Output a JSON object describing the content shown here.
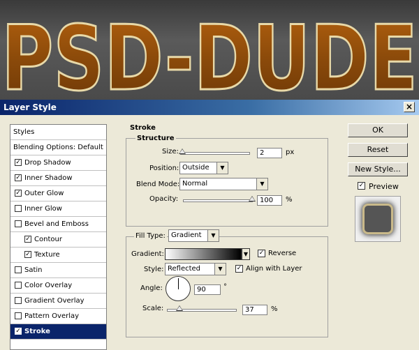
{
  "banner": {
    "text": "PSD-DUDE"
  },
  "window": {
    "title": "Layer Style",
    "close_glyph": "×"
  },
  "left_list": {
    "items": [
      {
        "label": "Styles",
        "checkbox": false,
        "checked": false
      },
      {
        "label": "Blending Options: Default",
        "checkbox": false,
        "checked": false
      },
      {
        "label": "Drop Shadow",
        "checkbox": true,
        "checked": true
      },
      {
        "label": "Inner Shadow",
        "checkbox": true,
        "checked": true
      },
      {
        "label": "Outer Glow",
        "checkbox": true,
        "checked": true
      },
      {
        "label": "Inner Glow",
        "checkbox": true,
        "checked": false
      },
      {
        "label": "Bevel and Emboss",
        "checkbox": true,
        "checked": false
      },
      {
        "label": "Contour",
        "checkbox": true,
        "checked": true
      },
      {
        "label": "Texture",
        "checkbox": true,
        "checked": true
      },
      {
        "label": "Satin",
        "checkbox": true,
        "checked": false
      },
      {
        "label": "Color Overlay",
        "checkbox": true,
        "checked": false
      },
      {
        "label": "Gradient Overlay",
        "checkbox": true,
        "checked": false
      },
      {
        "label": "Pattern Overlay",
        "checkbox": true,
        "checked": false
      },
      {
        "label": "Stroke",
        "checkbox": true,
        "checked": true,
        "selected": true
      }
    ]
  },
  "stroke": {
    "heading": "Stroke",
    "structure_heading": "Structure",
    "size_label": "Size:",
    "size_value": "2",
    "size_unit": "px",
    "position_label": "Position:",
    "position_value": "Outside",
    "blend_mode_label": "Blend Mode:",
    "blend_mode_value": "Normal",
    "opacity_label": "Opacity:",
    "opacity_value": "100",
    "opacity_unit": "%",
    "fill_type_label": "Fill Type:",
    "fill_type_value": "Gradient",
    "gradient_label": "Gradient:",
    "reverse_label": "Reverse",
    "reverse_checked": true,
    "style_label": "Style:",
    "style_value": "Reflected",
    "align_label": "Align with Layer",
    "align_checked": true,
    "angle_label": "Angle:",
    "angle_value": "90",
    "angle_unit": "°",
    "scale_label": "Scale:",
    "scale_value": "37",
    "scale_unit": "%"
  },
  "buttons": {
    "ok": "OK",
    "reset": "Reset",
    "new_style": "New Style...",
    "preview_label": "Preview",
    "preview_checked": true
  },
  "colors": {
    "banner_text": "#8b4a0a",
    "title_bar": "#0a246a",
    "selection": "#0a246a"
  }
}
